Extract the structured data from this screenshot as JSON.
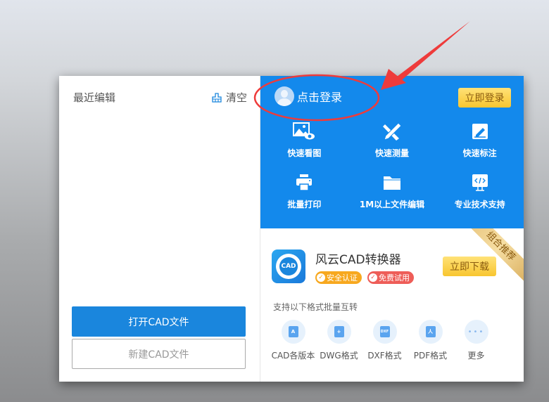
{
  "left_panel": {
    "title": "最近编辑",
    "clear_label": "清空",
    "open_button": "打开CAD文件",
    "new_button": "新建CAD文件"
  },
  "account": {
    "login_prompt": "点击登录",
    "login_button": "立即登录"
  },
  "features": [
    {
      "label": "快速看图",
      "icon": "image-view-icon"
    },
    {
      "label": "快速测量",
      "icon": "ruler-pencil-icon"
    },
    {
      "label": "快速标注",
      "icon": "annotate-icon"
    },
    {
      "label": "批量打印",
      "icon": "printer-icon"
    },
    {
      "label": "1M以上文件编辑",
      "icon": "folder-icon"
    },
    {
      "label": "专业技术支持",
      "icon": "code-monitor-icon"
    }
  ],
  "promo": {
    "ribbon": "组合推荐",
    "app_icon_text": "CAD",
    "app_name": "风云CAD转换器",
    "badges": [
      "安全认证",
      "免费试用"
    ],
    "download_button": "立即下载",
    "support_text": "支持以下格式批量互转",
    "formats": [
      {
        "label": "CAD各版本",
        "glyph": "A"
      },
      {
        "label": "DWG格式",
        "glyph": "+"
      },
      {
        "label": "DXF格式",
        "glyph": "DXF"
      },
      {
        "label": "PDF格式",
        "glyph": "人"
      },
      {
        "label": "更多",
        "glyph": "•••"
      }
    ]
  },
  "colors": {
    "primary_blue": "#1389ec",
    "gold_button": "#f8c630",
    "annotation_red": "#ee3b3b"
  }
}
